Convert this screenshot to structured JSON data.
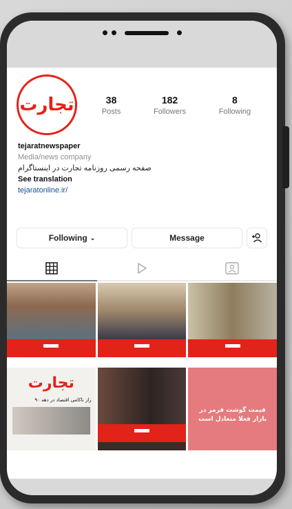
{
  "profile": {
    "avatar_text": "تجارت",
    "username": "tejaratnewspaper",
    "category": "Media/news company",
    "description": "صفحه رسمی روزنامه تجارت در اینستاگرام",
    "see_translation": "See translation",
    "link": "tejaratonline.ir/"
  },
  "stats": [
    {
      "value": "38",
      "label": "Posts"
    },
    {
      "value": "182",
      "label": "Followers"
    },
    {
      "value": "8",
      "label": "Following"
    }
  ],
  "actions": {
    "following_label": "Following",
    "message_label": "Message"
  },
  "tabs": [
    {
      "icon": "grid-icon",
      "active": true
    },
    {
      "icon": "reels-play-icon",
      "active": false
    },
    {
      "icon": "tagged-person-icon",
      "active": false
    }
  ],
  "posts": {
    "logo_text": "تجارت",
    "post4_headline": "راز ناکامی اقتصاد در دهه ۹۰",
    "post6_headline": "قیمت گوشت قرمز در بازار فعلا متعادل است"
  },
  "colors": {
    "brand_red": "#e2231a",
    "link_blue": "#1a4f8a"
  }
}
